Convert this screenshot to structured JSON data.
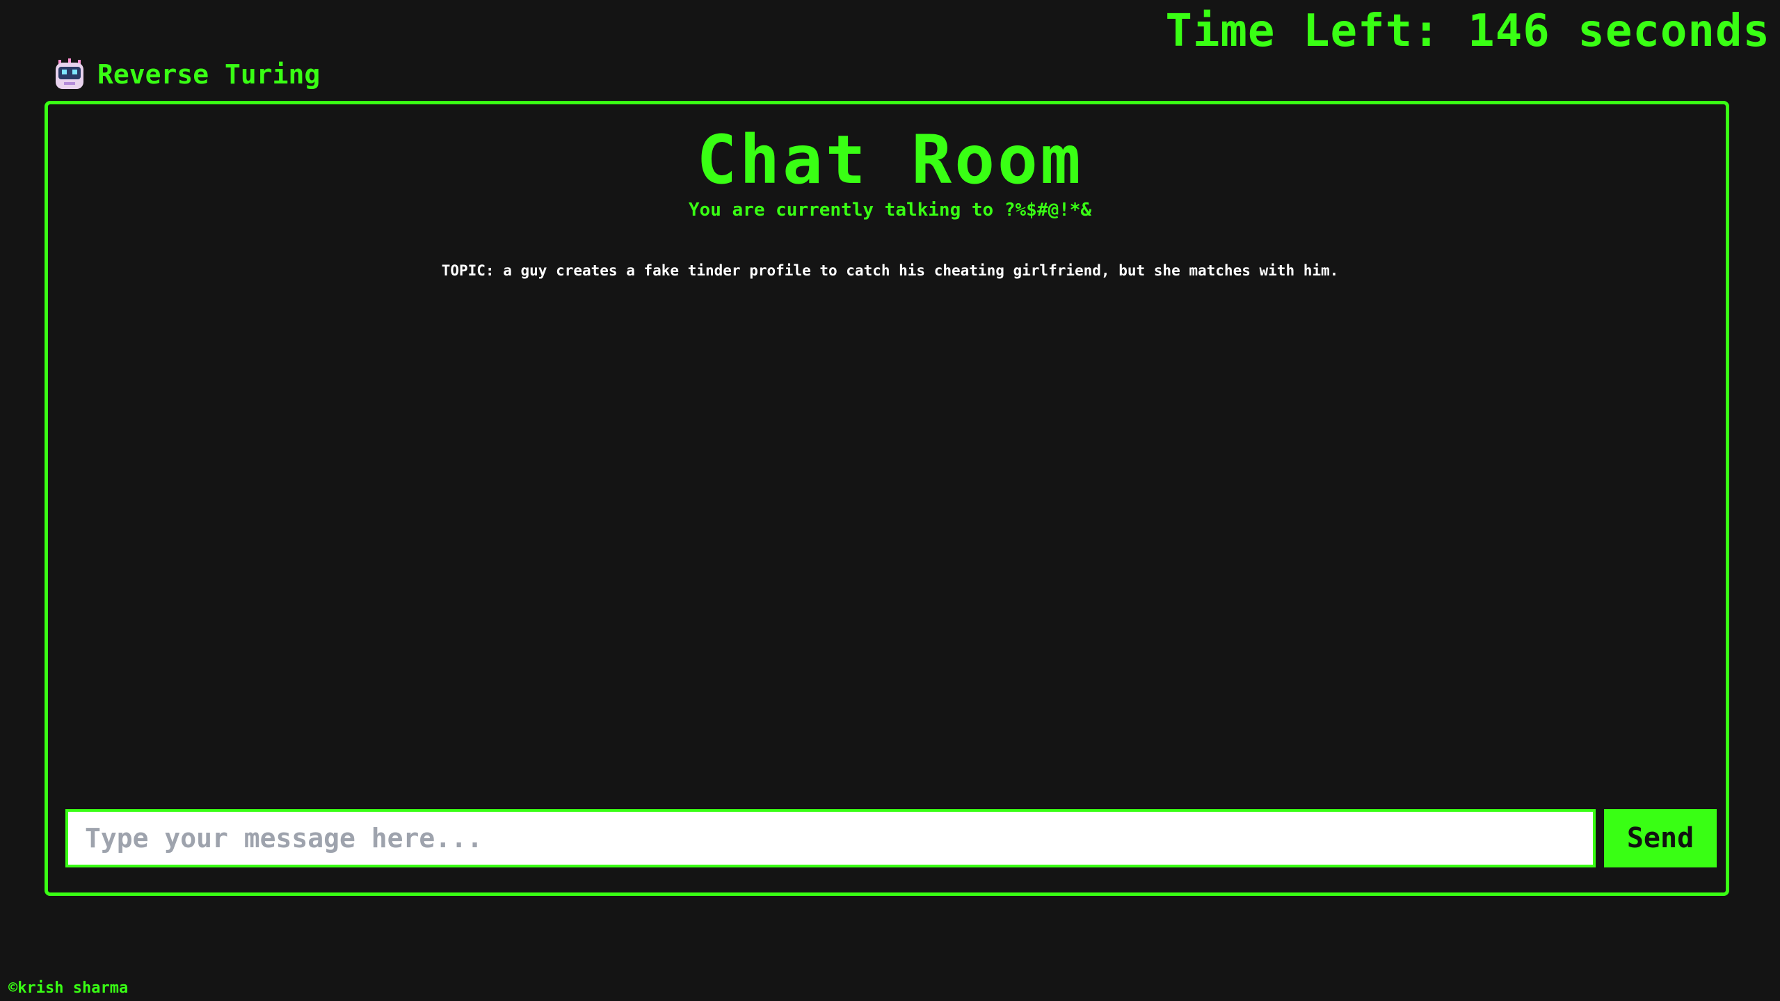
{
  "header": {
    "timer_text": "Time Left: 146 seconds",
    "brand_name": "Reverse Turing",
    "brand_icon": "robot-icon"
  },
  "chat": {
    "title": "Chat Room",
    "subtitle": "You are currently talking to ?%$#@!*&",
    "topic": "TOPIC: a guy creates a fake tinder profile to catch his cheating girlfriend, but she matches with him.",
    "input_placeholder": "Type your message here...",
    "input_value": "",
    "send_label": "Send"
  },
  "footer": {
    "credit": "©krish sharma"
  },
  "colors": {
    "background": "#141414",
    "accent": "#39ff14",
    "text_light": "#ffffff"
  }
}
